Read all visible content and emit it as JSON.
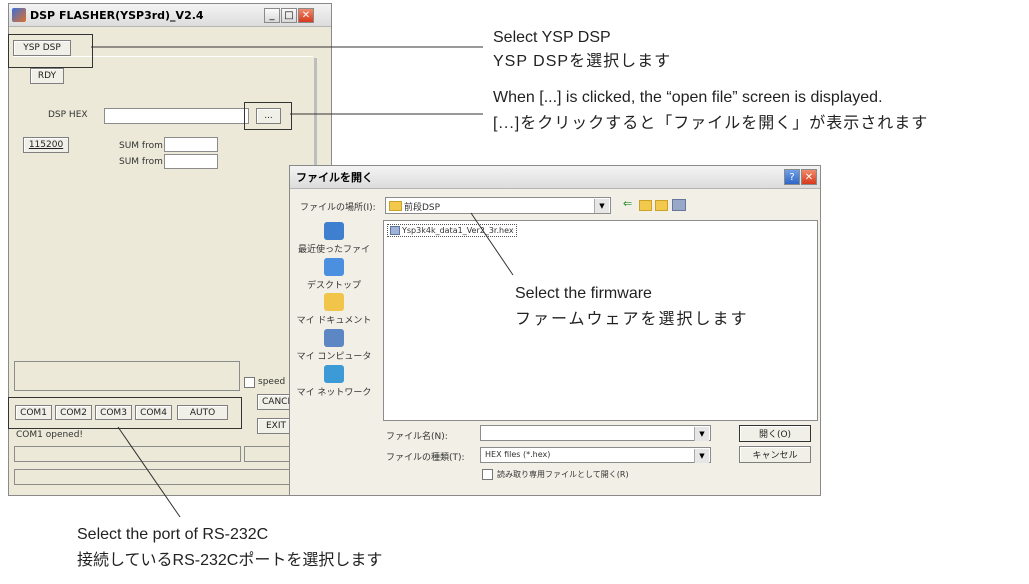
{
  "flasher": {
    "title": "DSP FLASHER(YSP3rd)_V2.4",
    "tab_label": "YSP DSP",
    "rdy_label": "RDY",
    "dsp_hex_label": "DSP HEX",
    "browse_label": "...",
    "baud_label": "115200",
    "sum_from_1": "SUM from",
    "sum_from_2": "SUM from",
    "speed_label": "speed",
    "com_buttons": [
      "COM1",
      "COM2",
      "COM3",
      "COM4",
      "AUTO"
    ],
    "cancel_label": "CANCE",
    "exit_label": "EXIT",
    "status": "COM1 opened!"
  },
  "open_dialog": {
    "title": "ファイルを開く",
    "look_in_label": "ファイルの場所(I):",
    "look_in_value": "前段DSP",
    "places": [
      "最近使ったファイル",
      "デスクトップ",
      "マイ ドキュメント",
      "マイ コンピュータ",
      "マイ ネットワーク"
    ],
    "file_item": "Ysp3k4k_data1_Ver2_3r.hex",
    "filename_label": "ファイル名(N):",
    "filetype_label": "ファイルの種類(T):",
    "filetype_value": "HEX files (*.hex)",
    "readonly_label": "読み取り専用ファイルとして開く(R)",
    "open_button": "開く(O)",
    "cancel_button": "キャンセル",
    "help_glyph": "?"
  },
  "annotations": {
    "select_dsp_en": "Select YSP DSP",
    "select_dsp_jp": "YSP DSPを選択します",
    "browse_en": "When [...] is clicked, the “open file” screen is displayed.",
    "browse_jp": "[...]をクリックすると「ファイルを開く」が表示されます",
    "firmware_en": "Select the firmware",
    "firmware_jp": "ファームウェアを選択します",
    "port_en": "Select the port of RS-232C",
    "port_jp": "接続しているRS-232Cポートを選択します"
  }
}
